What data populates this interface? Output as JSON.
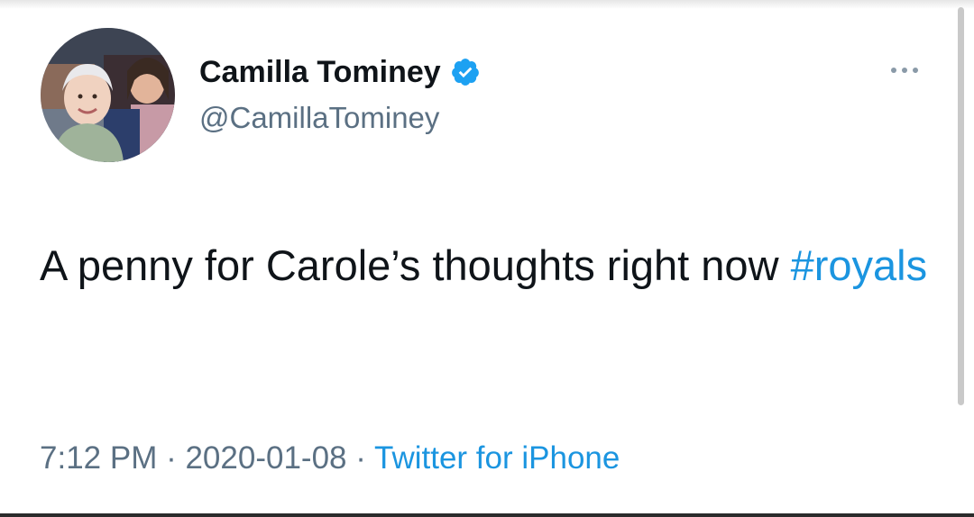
{
  "tweet": {
    "author": {
      "display_name": "Camilla Tominey",
      "handle": "@CamillaTominey",
      "verified": true,
      "avatar_icon": "profile-photo"
    },
    "text_before_hashtag": "A penny for Carole’s thoughts right now ",
    "hashtag": "#royals",
    "time": "7:12 PM",
    "separator": " · ",
    "date": "2020-01-08",
    "source": "Twitter for iPhone",
    "more_icon": "more-options-icon"
  },
  "colors": {
    "text_primary": "#0f1419",
    "text_secondary": "#5b7083",
    "accent_blue": "#1b95e0",
    "verified_badge": "#1da1f2"
  }
}
